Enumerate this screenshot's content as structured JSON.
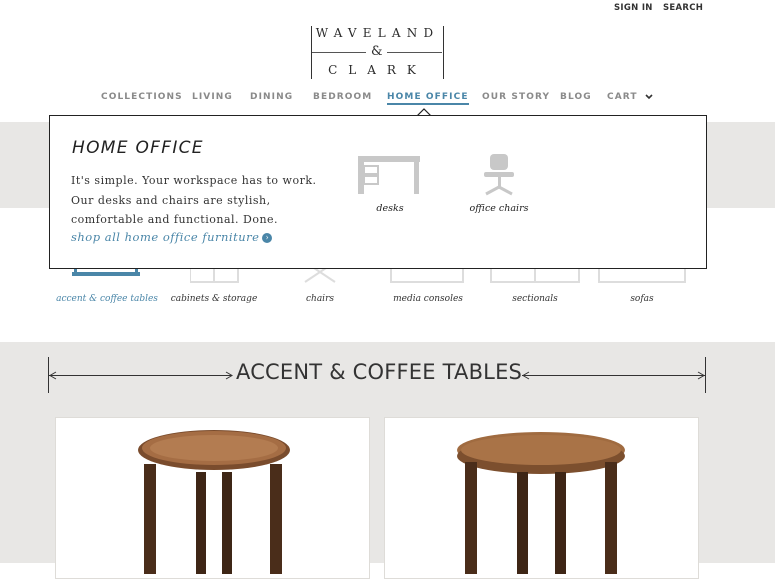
{
  "utility": {
    "sign_in": "SIGN IN",
    "search": "SEARCH"
  },
  "logo": {
    "line1": "WAVELAND",
    "amp": "&",
    "line2": "CLARK"
  },
  "nav": {
    "collections": "COLLECTIONS",
    "living": "LIVING",
    "dining": "DINING",
    "bedroom": "BEDROOM",
    "home_office": "HOME OFFICE",
    "our_story": "OUR STORY",
    "blog": "BLOG",
    "cart": "CART"
  },
  "categories": [
    "accent & coffee tables",
    "cabinets & storage",
    "chairs",
    "media consoles",
    "sectionals",
    "sofas"
  ],
  "section_title": "ACCENT & COFFEE TABLES",
  "dropdown": {
    "title": "HOME OFFICE",
    "description": "It's simple. Your workspace has to work. Our desks and chairs are stylish, comfortable and functional. Done.",
    "link": "shop all home office furniture",
    "items": [
      "desks",
      "office chairs"
    ]
  },
  "colors": {
    "accent": "#4a86a8",
    "band": "#e8e7e5",
    "text": "#2b2b2b"
  }
}
